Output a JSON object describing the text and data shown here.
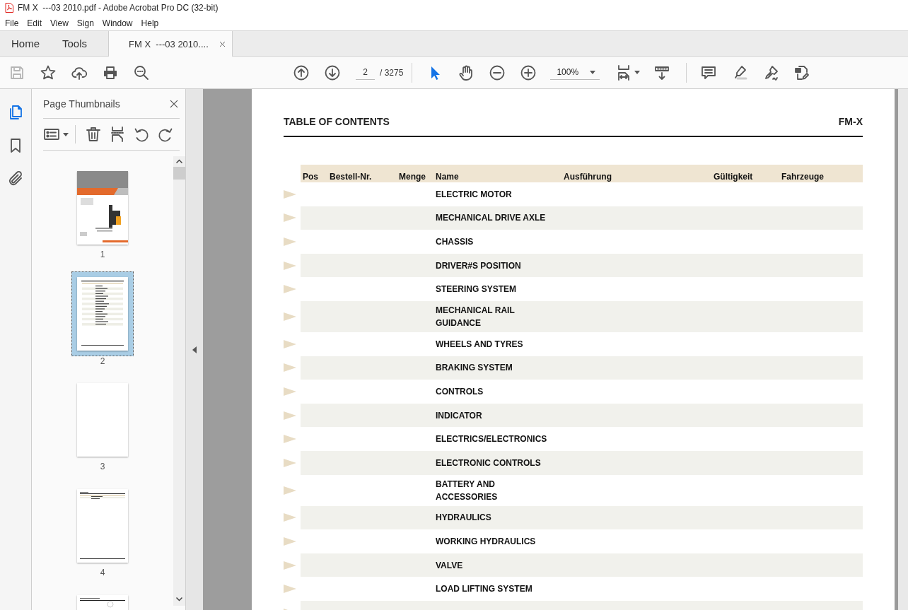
{
  "window": {
    "title": "FM X  ---03 2010.pdf - Adobe Acrobat Pro DC (32-bit)"
  },
  "menu": [
    "File",
    "Edit",
    "View",
    "Sign",
    "Window",
    "Help"
  ],
  "tabs": [
    {
      "label": "Home",
      "kind": "nav",
      "selected": false
    },
    {
      "label": "Tools",
      "kind": "nav",
      "selected": false
    },
    {
      "label": "FM X  ---03 2010....",
      "kind": "document",
      "selected": true
    }
  ],
  "toolbar": {
    "left_tools": [
      {
        "kind": "save",
        "disabled": true
      },
      {
        "kind": "star",
        "disabled": false
      },
      {
        "kind": "upload",
        "disabled": false
      },
      {
        "kind": "print",
        "disabled": false
      },
      {
        "kind": "find",
        "disabled": false
      }
    ],
    "page_input": "2",
    "page_total": "/ 3275",
    "view_tools": [
      {
        "kind": "select",
        "selected": true
      },
      {
        "kind": "hand",
        "selected": false
      },
      {
        "kind": "zoom-out",
        "selected": false
      },
      {
        "kind": "zoom-in",
        "selected": false
      }
    ],
    "zoom": "100%"
  },
  "sidebar": {
    "rail": [
      {
        "kind": "pages",
        "selected": true
      },
      {
        "kind": "bookmark",
        "selected": false
      },
      {
        "kind": "attachment",
        "selected": false
      }
    ],
    "panel_title": "Page Thumbnails",
    "thumbnails": [
      {
        "kind": "cover",
        "label": "1",
        "selected": false
      },
      {
        "kind": "contents",
        "label": "2",
        "selected": true
      },
      {
        "kind": "blank",
        "label": "3",
        "selected": false
      },
      {
        "kind": "list",
        "label": "4",
        "selected": false
      },
      {
        "kind": "cut",
        "selected": false
      }
    ]
  },
  "document": {
    "heading": "TABLE OF CONTENTS",
    "model": "FM-X",
    "columns": [
      "Pos",
      "Bestell-Nr.",
      "Menge",
      "Name",
      "Ausführung",
      "Gültigkeit",
      "Fahrzeuge"
    ],
    "rows": [
      {
        "name": "ELECTRIC MOTOR"
      },
      {
        "name": "MECHANICAL DRIVE AXLE"
      },
      {
        "name": "CHASSIS"
      },
      {
        "name": "DRIVER#S POSITION"
      },
      {
        "name": "STEERING SYSTEM"
      },
      {
        "name": "MECHANICAL RAIL GUIDANCE"
      },
      {
        "name": "WHEELS AND TYRES"
      },
      {
        "name": "BRAKING SYSTEM"
      },
      {
        "name": "CONTROLS"
      },
      {
        "name": "INDICATOR"
      },
      {
        "name": "ELECTRICS/ELECTRONICS"
      },
      {
        "name": "ELECTRONIC CONTROLS"
      },
      {
        "name": "BATTERY AND ACCESSORIES"
      },
      {
        "name": "HYDRAULICS"
      },
      {
        "name": "WORKING HYDRAULICS"
      },
      {
        "name": "VALVE"
      },
      {
        "name": "LOAD LIFTING SYSTEM"
      }
    ]
  }
}
